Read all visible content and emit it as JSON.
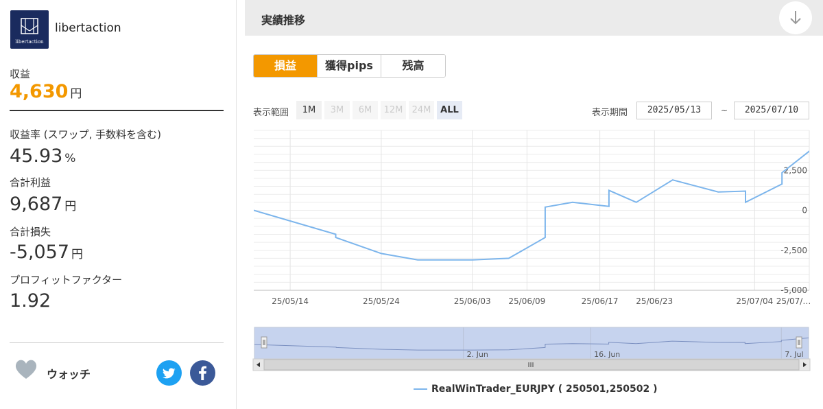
{
  "profile": {
    "logo_text": "libertaction",
    "name": "libertaction"
  },
  "stats": {
    "profit_label": "収益",
    "profit_value": "4,630",
    "profit_unit": "円",
    "rate_label": "収益率 (スワップ, 手数料を含む)",
    "rate_value": "45.93",
    "rate_unit": "%",
    "gross_profit_label": "合計利益",
    "gross_profit_value": "9,687",
    "gross_profit_unit": "円",
    "gross_loss_label": "合計損失",
    "gross_loss_value": "-5,057",
    "gross_loss_unit": "円",
    "pf_label": "プロフィットファクター",
    "pf_value": "1.92"
  },
  "watch": {
    "label": "ウォッチ",
    "icon": "heart-icon"
  },
  "social": {
    "twitter_icon": "twitter-icon",
    "facebook_icon": "facebook-icon"
  },
  "section": {
    "title": "実績推移",
    "collapse_icon": "arrow-down-icon"
  },
  "tabs": [
    {
      "label": "損益",
      "active": true
    },
    {
      "label": "獲得pips",
      "active": false
    },
    {
      "label": "残高",
      "active": false
    }
  ],
  "range": {
    "label": "表示範囲",
    "buttons": [
      {
        "label": "1M",
        "state": "enabled"
      },
      {
        "label": "3M",
        "state": "disabled"
      },
      {
        "label": "6M",
        "state": "disabled"
      },
      {
        "label": "12M",
        "state": "disabled"
      },
      {
        "label": "24M",
        "state": "disabled"
      },
      {
        "label": "ALL",
        "state": "selected"
      }
    ]
  },
  "period": {
    "label": "表示期間",
    "from": "2025/05/13",
    "separator": "~",
    "to": "2025/07/10"
  },
  "colors": {
    "accent": "#f39800",
    "series": "#7cb5ec",
    "navigator_fill": "#c6d3ee"
  },
  "chart_data": {
    "type": "line",
    "title": "",
    "xlabel": "",
    "ylabel": "",
    "ylim": [
      -5000,
      5000
    ],
    "xlim": [
      "2025-05-10",
      "2025-07-10"
    ],
    "y_ticks": [
      2500,
      0,
      -2500,
      -5000
    ],
    "y_tick_labels": [
      "2,500",
      "0",
      "-2,500",
      "-5,000"
    ],
    "x_ticks": [
      "2025-05-14",
      "2025-05-24",
      "2025-06-03",
      "2025-06-09",
      "2025-06-17",
      "2025-06-23",
      "2025-07-04",
      "2025-07-10"
    ],
    "x_tick_labels": [
      "25/05/14",
      "25/05/24",
      "25/06/03",
      "25/06/09",
      "25/06/17",
      "25/06/23",
      "25/07/04",
      "25/07/…"
    ],
    "grid": true,
    "legend_placement": "bottom",
    "series": [
      {
        "name": "RealWinTrader_EURJPY ( 250501,250502 )",
        "points": [
          [
            "2025-05-10",
            0
          ],
          [
            "2025-05-19",
            -1500
          ],
          [
            "2025-05-19",
            -1700
          ],
          [
            "2025-05-24",
            -2700
          ],
          [
            "2025-05-28",
            -3100
          ],
          [
            "2025-06-03",
            -3100
          ],
          [
            "2025-06-07",
            -3000
          ],
          [
            "2025-06-11",
            -1700
          ],
          [
            "2025-06-11",
            200
          ],
          [
            "2025-06-14",
            500
          ],
          [
            "2025-06-18",
            250
          ],
          [
            "2025-06-18",
            1250
          ],
          [
            "2025-06-21",
            500
          ],
          [
            "2025-06-25",
            1900
          ],
          [
            "2025-06-30",
            1150
          ],
          [
            "2025-07-03",
            1200
          ],
          [
            "2025-07-03",
            500
          ],
          [
            "2025-07-07",
            1650
          ],
          [
            "2025-07-07",
            2350
          ],
          [
            "2025-07-10",
            3700
          ],
          [
            "2025-07-15",
            4500
          ]
        ]
      }
    ],
    "navigator": {
      "labels": [
        "2. Jun",
        "16. Jun",
        "7. Jul"
      ],
      "scrollbar_icon": "scroll-grip-icon"
    }
  }
}
